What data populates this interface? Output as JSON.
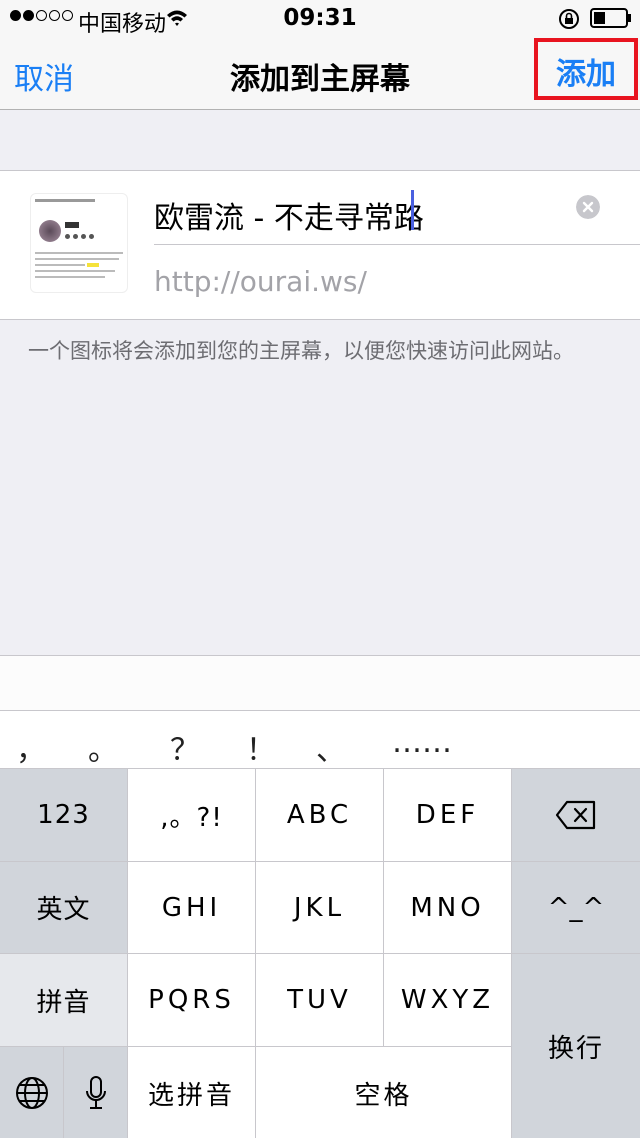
{
  "status_bar": {
    "carrier": "中国移动",
    "time": "09:31"
  },
  "nav": {
    "cancel": "取消",
    "title": "添加到主屏幕",
    "add": "添加",
    "accent_color": "#1a7ff5",
    "highlight_color": "#e8141f"
  },
  "form": {
    "title_value": "欧雷流 - 不走寻常路",
    "url": "http://ourai.ws/",
    "help": "一个图标将会添加到您的主屏幕，以便您快速访问此网站。"
  },
  "candidates": [
    "，",
    "。",
    "？",
    "！",
    "、",
    "……"
  ],
  "keyboard": {
    "row1": [
      "123",
      ",。?!",
      "ABC",
      "DEF"
    ],
    "row2": [
      "英文",
      "GHI",
      "JKL",
      "MNO",
      "^_^"
    ],
    "row3": [
      "拼音",
      "PQRS",
      "TUV",
      "WXYZ"
    ],
    "return_label": "换行",
    "pinyin_select": "选拼音",
    "space": "空格"
  }
}
